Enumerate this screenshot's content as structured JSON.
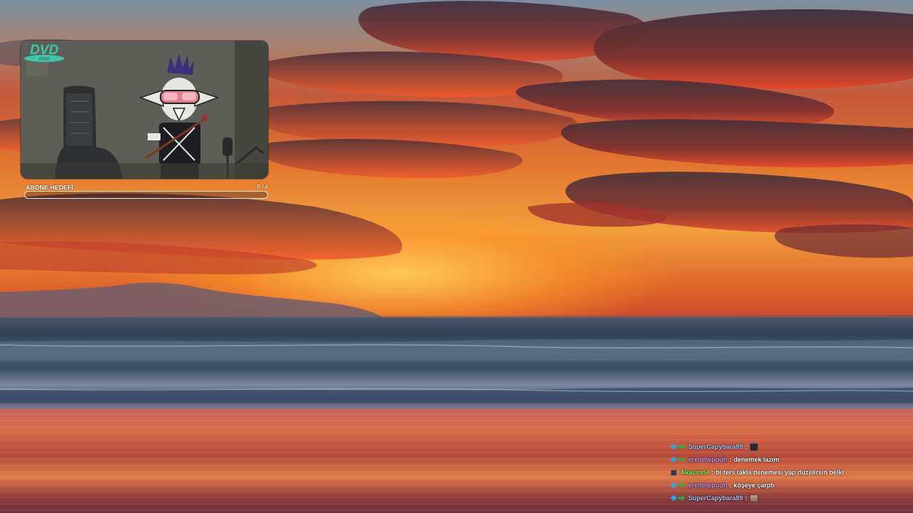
{
  "overlay": {
    "goal": {
      "title": "ABONE HEDEFİ",
      "count": "0 / 4",
      "progress": 0
    }
  },
  "chat": {
    "messages": [
      {
        "user": "SuperCapybara89",
        "user_color": "#a9c8ff",
        "badges": [
          "blue-diamond",
          "green-arrow"
        ],
        "text": "",
        "emote": "dark-square-emote"
      },
      {
        "user": "erenthepooh",
        "user_color": "#c59cff",
        "badges": [
          "blue-diamond",
          "green-arrow"
        ],
        "text": "denemek lazım",
        "emote": ""
      },
      {
        "user": "AkaLinn4",
        "user_color": "#7cff5e",
        "badges": [
          "dark-square"
        ],
        "text": "bi ters takla denemesi yap düzelirsin belki",
        "emote": ""
      },
      {
        "user": "erenthepooh",
        "user_color": "#c59cff",
        "badges": [
          "blue-diamond",
          "green-arrow"
        ],
        "text": "köşeye çarptı",
        "emote": ""
      },
      {
        "user": "SuperCapybara89",
        "user_color": "#a9c8ff",
        "badges": [
          "blue-diamond",
          "green-arrow"
        ],
        "text": "",
        "emote": "face-emote"
      }
    ],
    "separator": ":"
  },
  "webcam": {
    "logo_icon": "dvd-video-logo"
  }
}
